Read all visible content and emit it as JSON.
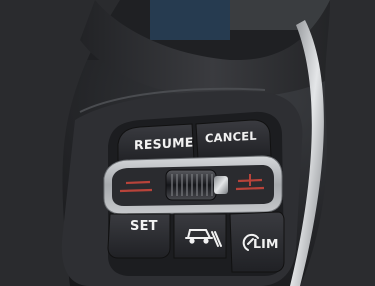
{
  "buttons": {
    "resume": "RESUME",
    "cancel": "CANCEL",
    "set": "SET",
    "limiter": "LIM"
  },
  "icons": [
    "distance-icon",
    "speed-limiter-icon",
    "speed-minus-icon",
    "speed-plus-icon"
  ],
  "colors": {
    "button_face": "#2b2c30",
    "bezel_silver": "#b9bcc0",
    "accent_red": "#b8433a",
    "label_white": "#f2f2f2"
  }
}
